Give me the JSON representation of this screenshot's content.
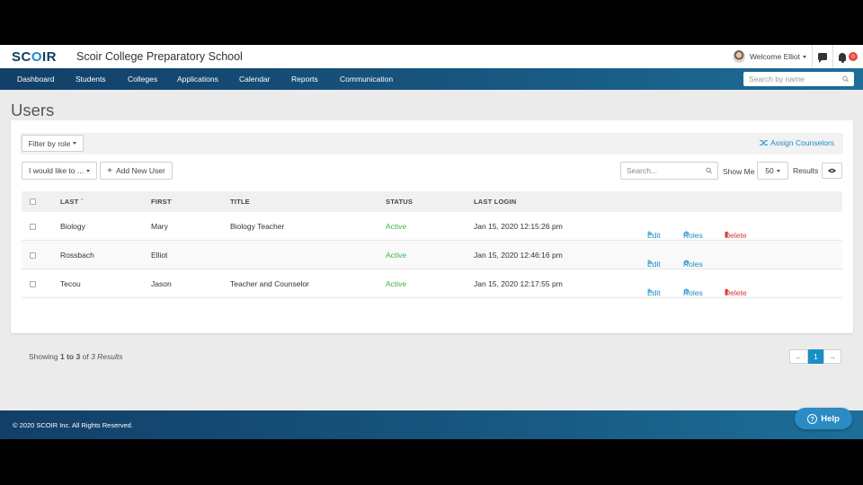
{
  "header": {
    "logo": "SCOIR",
    "school_name": "Scoir College Preparatory School",
    "welcome": "Welcome Elliot",
    "notification_count": "0"
  },
  "nav": {
    "items": [
      "Dashboard",
      "Students",
      "Colleges",
      "Applications",
      "Calendar",
      "Reports",
      "Communication"
    ],
    "search_placeholder": "Search by name"
  },
  "page": {
    "title": "Users"
  },
  "toolbar": {
    "filter_label": "Filter by role",
    "assign_label": "Assign Counselors",
    "action_label": "I would like to ...",
    "add_user_label": "Add New User",
    "search_placeholder": "Search...",
    "show_me_label": "Show Me",
    "page_size": "50",
    "results_label": "Results"
  },
  "table": {
    "columns": [
      "LAST",
      "FIRST",
      "TITLE",
      "STATUS",
      "LAST LOGIN"
    ],
    "rows": [
      {
        "last": "Biology",
        "first": "Mary",
        "title": "Biology Teacher",
        "status": "Active",
        "last_login": "Jan 15, 2020 12:15:26 pm",
        "edit": "Edit",
        "roles": "Roles",
        "delete": "Delete"
      },
      {
        "last": "Rossbach",
        "first": "Elliot",
        "title": "",
        "status": "Active",
        "last_login": "Jan 15, 2020 12:46:16 pm",
        "edit": "Edit",
        "roles": "Roles",
        "delete": ""
      },
      {
        "last": "Tecou",
        "first": "Jason",
        "title": "Teacher and Counselor",
        "status": "Active",
        "last_login": "Jan 15, 2020 12:17:55 pm",
        "edit": "Edit",
        "roles": "Roles",
        "delete": "Delete"
      }
    ]
  },
  "pagination": {
    "showing_prefix": "Showing",
    "range_from": "1",
    "range_to_word": "to",
    "range_to": "3",
    "of_word": "of",
    "total": "3 Results",
    "current_page": "1"
  },
  "footer": {
    "copyright": "© 2020 SCOIR Inc. All Rights Reserved.",
    "help_label": "Help"
  },
  "colors": {
    "brand_blue": "#1a8ec9",
    "nav_dark": "#123f68",
    "status_active": "#3cb54a",
    "delete_red": "#d9383a"
  }
}
